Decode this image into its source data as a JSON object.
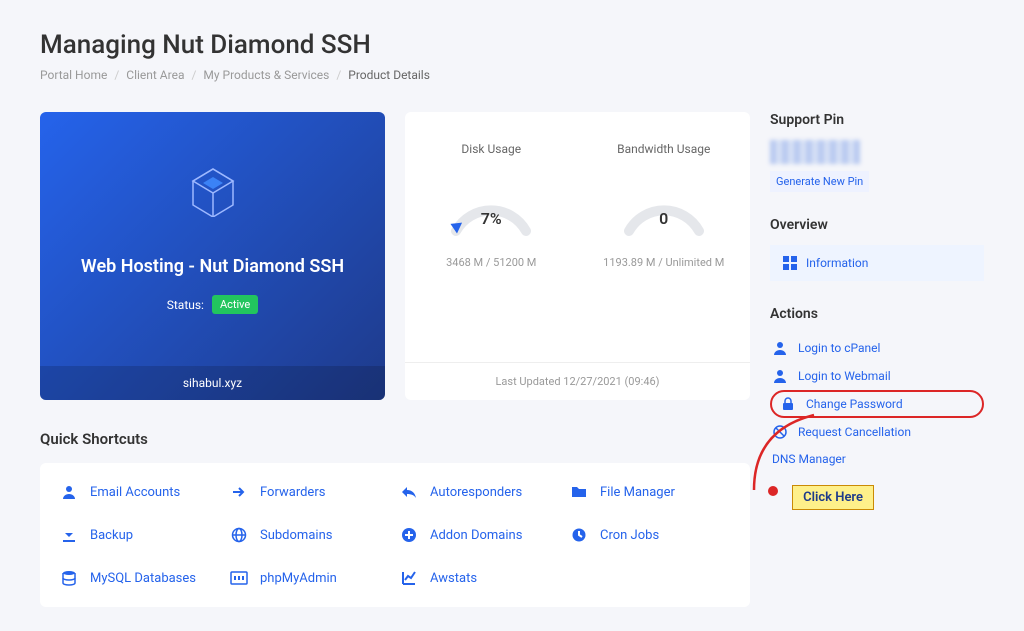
{
  "page": {
    "title": "Managing Nut Diamond SSH"
  },
  "breadcrumb": {
    "items": [
      "Portal Home",
      "Client Area",
      "My Products & Services"
    ],
    "current": "Product Details"
  },
  "product": {
    "name": "Web Hosting - Nut Diamond SSH",
    "status_label": "Status:",
    "status_value": "Active",
    "domain": "sihabul.xyz"
  },
  "usage": {
    "disk": {
      "title": "Disk Usage",
      "value": "7%",
      "detail": "3468 M / 51200 M"
    },
    "bandwidth": {
      "title": "Bandwidth Usage",
      "value": "0",
      "detail": "1193.89 M / Unlimited M"
    },
    "updated": "Last Updated 12/27/2021 (09:46)"
  },
  "shortcuts": {
    "title": "Quick Shortcuts",
    "items": [
      {
        "icon": "person-icon",
        "label": "Email Accounts"
      },
      {
        "icon": "arrow-right-icon",
        "label": "Forwarders"
      },
      {
        "icon": "reply-icon",
        "label": "Autoresponders"
      },
      {
        "icon": "folder-icon",
        "label": "File Manager"
      },
      {
        "icon": "download-icon",
        "label": "Backup"
      },
      {
        "icon": "globe-icon",
        "label": "Subdomains"
      },
      {
        "icon": "plus-circle-icon",
        "label": "Addon Domains"
      },
      {
        "icon": "clock-icon",
        "label": "Cron Jobs"
      },
      {
        "icon": "database-icon",
        "label": "MySQL Databases"
      },
      {
        "icon": "php-icon",
        "label": "phpMyAdmin"
      },
      {
        "icon": "chart-icon",
        "label": "Awstats"
      }
    ]
  },
  "sidebar": {
    "support_pin": {
      "title": "Support Pin",
      "generate": "Generate New Pin"
    },
    "overview": {
      "title": "Overview",
      "item": "Information"
    },
    "actions": {
      "title": "Actions",
      "items": [
        {
          "icon": "person-icon",
          "label": "Login to cPanel"
        },
        {
          "icon": "person-icon",
          "label": "Login to Webmail"
        },
        {
          "icon": "lock-icon",
          "label": "Change Password",
          "highlight": true
        },
        {
          "icon": "cancel-icon",
          "label": "Request Cancellation"
        },
        {
          "icon": "",
          "label": "DNS Manager"
        }
      ]
    }
  },
  "annotation": {
    "label": "Click Here"
  }
}
